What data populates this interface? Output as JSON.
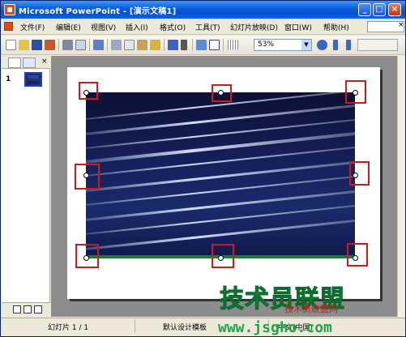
{
  "window": {
    "title": "Microsoft PowerPoint - [演示文稿1]",
    "controls": {
      "minimize": "_",
      "maximize": "□",
      "close": "×"
    }
  },
  "menu": {
    "items": [
      "文件(F)",
      "编辑(E)",
      "视图(V)",
      "插入(I)",
      "格式(O)",
      "工具(T)",
      "幻灯片放映(D)",
      "窗口(W)",
      "帮助(H)"
    ],
    "close": "×"
  },
  "toolbar": {
    "zoom": "53%",
    "icons": [
      "new-icon",
      "open-icon",
      "save-icon",
      "permission-icon",
      "print-icon",
      "print-preview-icon",
      "spelling-icon",
      "cut-icon",
      "copy-icon",
      "paste-icon",
      "format-painter-icon",
      "undo-icon",
      "chart-icon",
      "table-icon",
      "grid-icon",
      "help-icon"
    ]
  },
  "outline": {
    "slide_number": "1",
    "close": "×"
  },
  "status": {
    "slide": "幻灯片 1 / 1",
    "design": "默认设计模板",
    "language": "中文(中国)"
  },
  "watermark": {
    "title": "技术员联盟",
    "subtitle": "技术员联盟网",
    "url": "www.jsgho.com"
  },
  "colors": {
    "title_bar": "#0a5bd9",
    "highlight": "#d01818",
    "watermark_green": "#1ca64a",
    "watermark_red": "#d21d1d"
  }
}
